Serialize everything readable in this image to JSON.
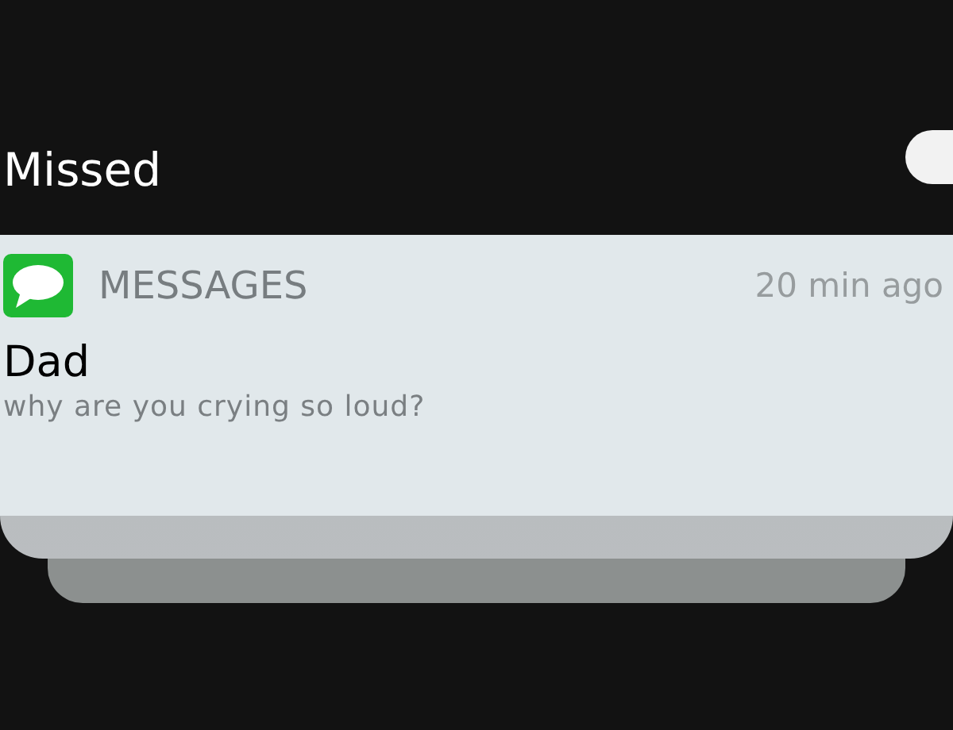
{
  "section": {
    "title": "Missed"
  },
  "notification": {
    "app": "MESSAGES",
    "time": "20 min ago",
    "sender": "Dad",
    "message": "why are you crying so loud?"
  }
}
